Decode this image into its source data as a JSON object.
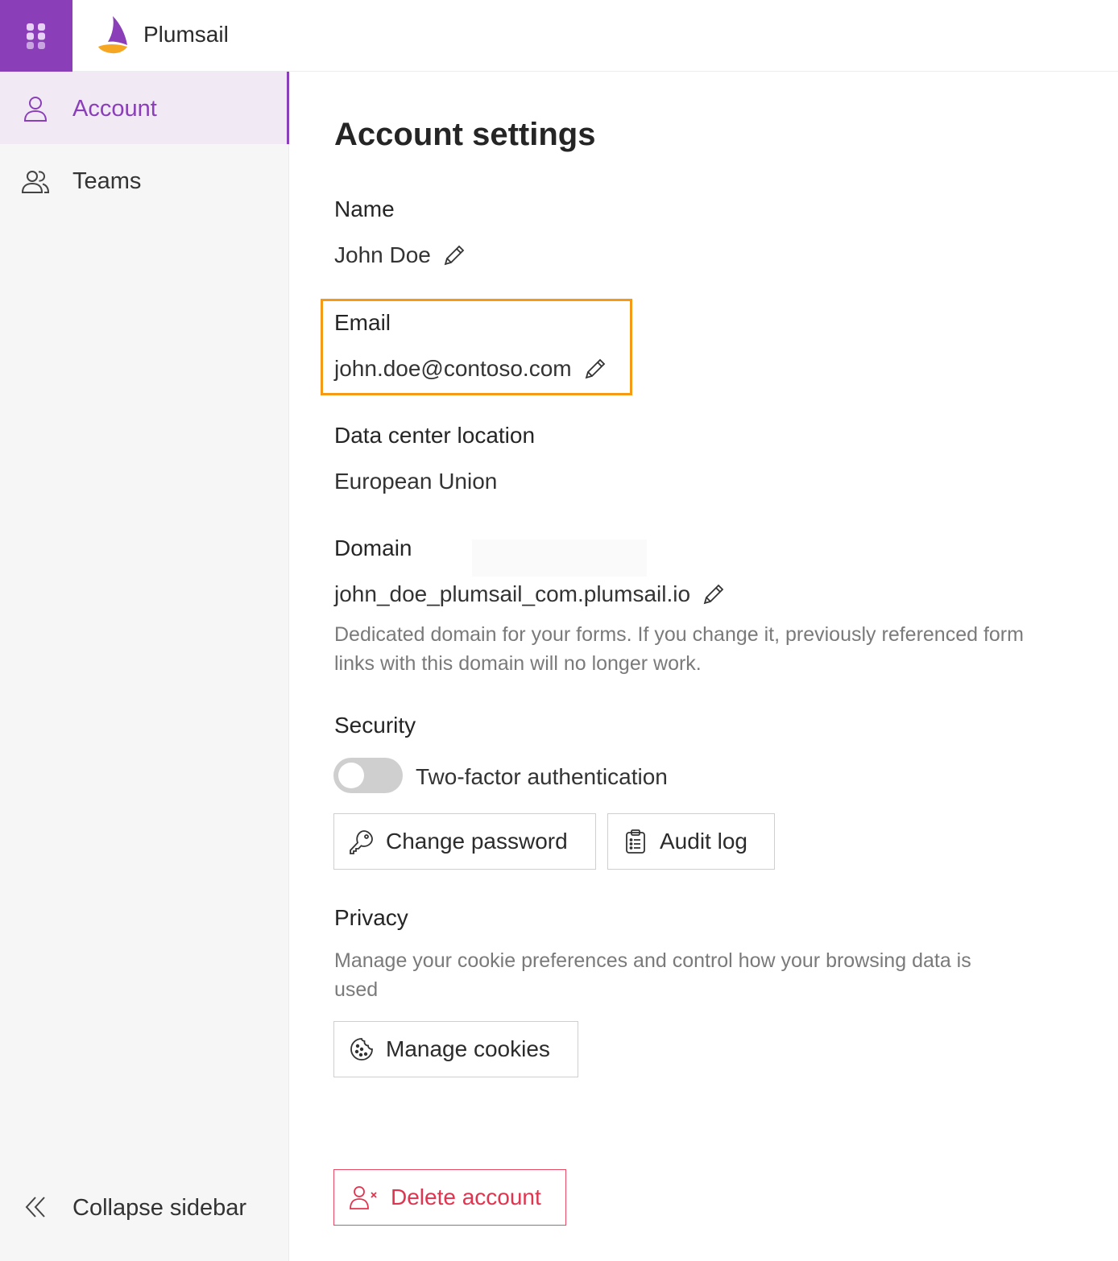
{
  "app": {
    "brand": "Plumsail"
  },
  "sidebar": {
    "items": [
      {
        "label": "Account",
        "active": true
      },
      {
        "label": "Teams",
        "active": false
      }
    ],
    "collapse_label": "Collapse sidebar"
  },
  "main": {
    "title": "Account settings",
    "name": {
      "label": "Name",
      "value": "John Doe"
    },
    "email": {
      "label": "Email",
      "value": "john.doe@contoso.com"
    },
    "data_center": {
      "label": "Data center location",
      "value": "European Union"
    },
    "domain": {
      "label": "Domain",
      "value": "john_doe_plumsail_com.plumsail.io",
      "help": "Dedicated domain for your forms. If you change it, previously referenced form links with this domain will no longer work."
    },
    "security": {
      "label": "Security",
      "two_factor_label": "Two-factor authentication",
      "two_factor_enabled": false,
      "change_password_label": "Change password",
      "audit_log_label": "Audit log"
    },
    "privacy": {
      "label": "Privacy",
      "help": "Manage your cookie preferences and control how your browsing data is used",
      "manage_cookies_label": "Manage cookies"
    },
    "delete_account_label": "Delete account"
  },
  "colors": {
    "brand_purple": "#8a3fb8",
    "highlight_orange": "#f59a14",
    "danger_red": "#e0344f"
  },
  "icons": {
    "app_launcher": "grid-dots-icon",
    "account": "user-icon",
    "teams": "users-icon",
    "collapse": "double-chevron-left-icon",
    "edit": "pencil-icon",
    "change_password": "key-icon",
    "audit_log": "clipboard-list-icon",
    "cookies": "cookie-icon",
    "delete": "user-remove-icon"
  }
}
